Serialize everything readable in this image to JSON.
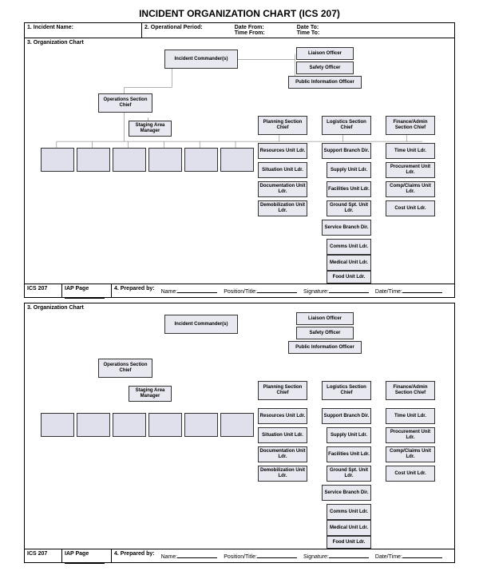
{
  "title": "INCIDENT ORGANIZATION CHART (ICS 207)",
  "row1": {
    "incidentLabel": "1. Incident Name:",
    "operLabel": "2. Operational Period:",
    "dateFrom": "Date From:",
    "timeFrom": "Time From:",
    "dateTo": "Date To:",
    "timeTo": "Time To:"
  },
  "chartLabel": "3. Organization Chart",
  "boxes": {
    "ic": "Incident Commander(s)",
    "liaison": "Liaison Officer",
    "safety": "Safety Officer",
    "pio": "Public Information Officer",
    "ops": "Operations Section Chief",
    "staging": "Staging Area Manager",
    "planning": "Planning Section Chief",
    "logistics": "Logistics Section Chief",
    "finance": "Finance/Admin Section Chief",
    "resources": "Resources Unit Ldr.",
    "situation": "Situation Unit Ldr.",
    "documentation": "Documentation Unit Ldr.",
    "demob": "Demobilization Unit Ldr.",
    "supportBranch": "Support Branch Dir.",
    "supply": "Supply Unit Ldr.",
    "facilities": "Facilities Unit Ldr.",
    "ground": "Ground Spt. Unit Ldr.",
    "serviceBranch": "Service Branch Dir.",
    "comms": "Comms Unit Ldr.",
    "medical": "Medical Unit Ldr.",
    "food": "Food Unit Ldr.",
    "time": "Time Unit Ldr.",
    "procurement": "Procurement Unit Ldr.",
    "compClaims": "Comp/Claims Unit Ldr.",
    "cost": "Cost Unit Ldr."
  },
  "footer": {
    "ics": "ICS 207",
    "iap": "IAP Page",
    "prepared": "4. Prepared by:",
    "name": "Name:",
    "position": "Position/Title:",
    "signature": "Signature:",
    "datetime": "Date/Time:"
  }
}
